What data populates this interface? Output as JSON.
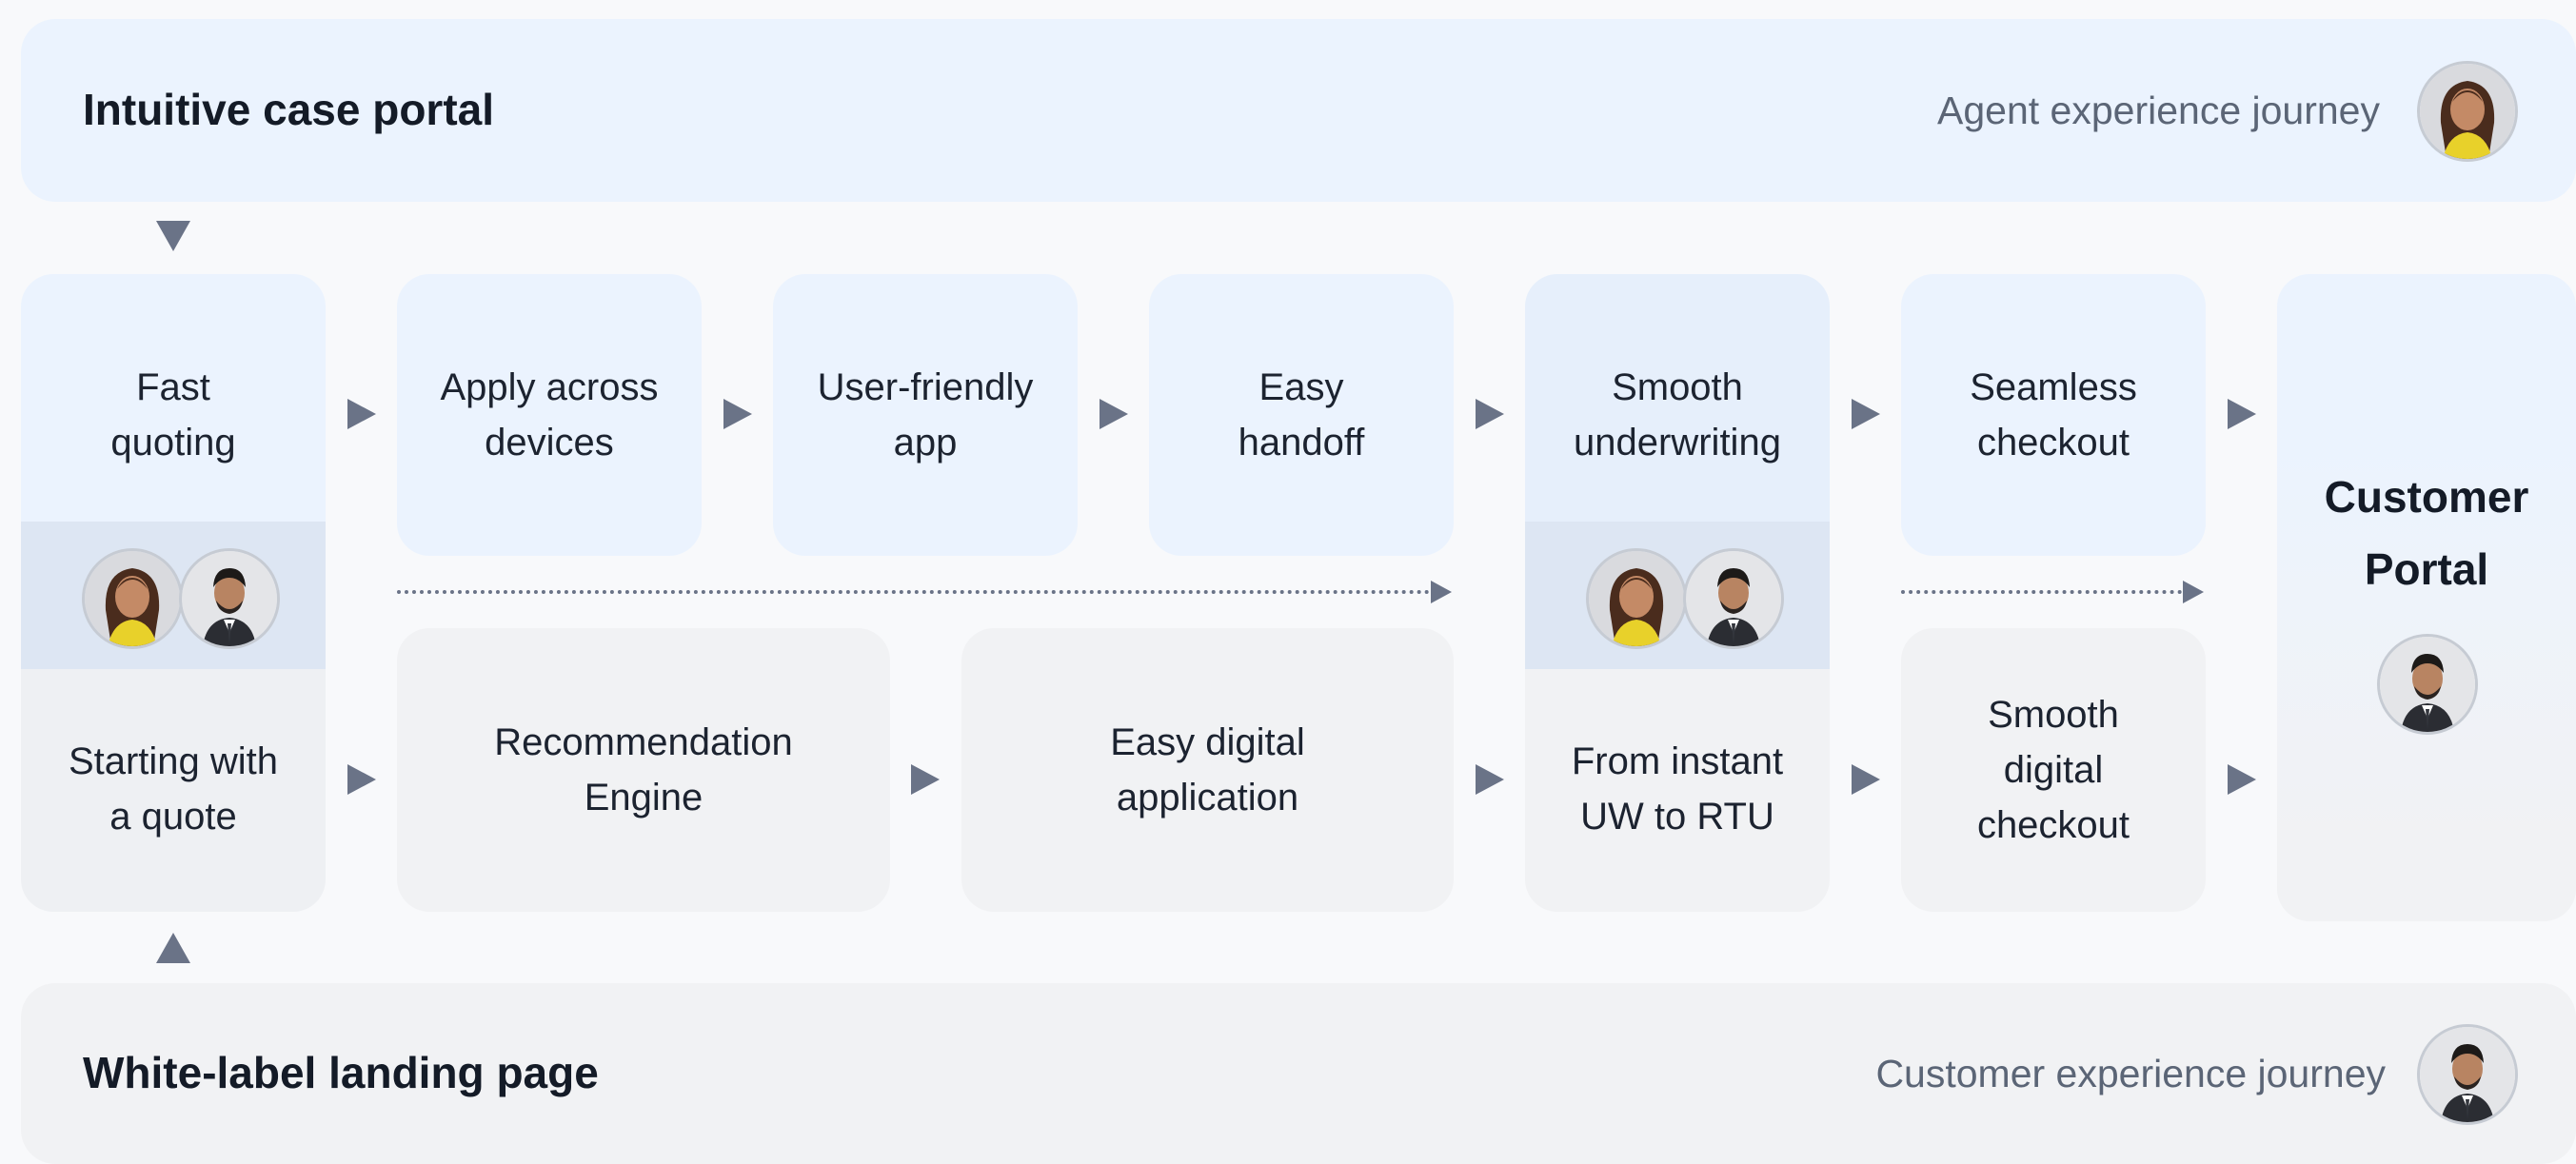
{
  "agent_banner": {
    "title": "Intuitive case portal",
    "journey": "Agent experience journey",
    "avatar_icon": "agent-woman-avatar"
  },
  "customer_banner": {
    "title": "White-label landing page",
    "journey": "Customer experience journey",
    "avatar_icon": "customer-man-avatar"
  },
  "agent_steps": [
    "Fast\nquoting",
    "Apply across\ndevices",
    "User-friendly\napp",
    "Easy\nhandoff",
    "Smooth\nunderwriting",
    "Seamless\ncheckout"
  ],
  "customer_steps": [
    "Starting with\na quote",
    "Recommendation\nEngine",
    "Easy digital\napplication",
    "From instant\nUW to RTU",
    "Smooth\ndigital\ncheckout"
  ],
  "portal": {
    "title": "Customer\nPortal",
    "avatar_icon": "customer-man-avatar"
  },
  "colors": {
    "agent_bg": "#ebf3fe",
    "customer_bg": "#f1f2f4",
    "shared_band": "#dde6f3",
    "arrow": "#6a7387"
  }
}
